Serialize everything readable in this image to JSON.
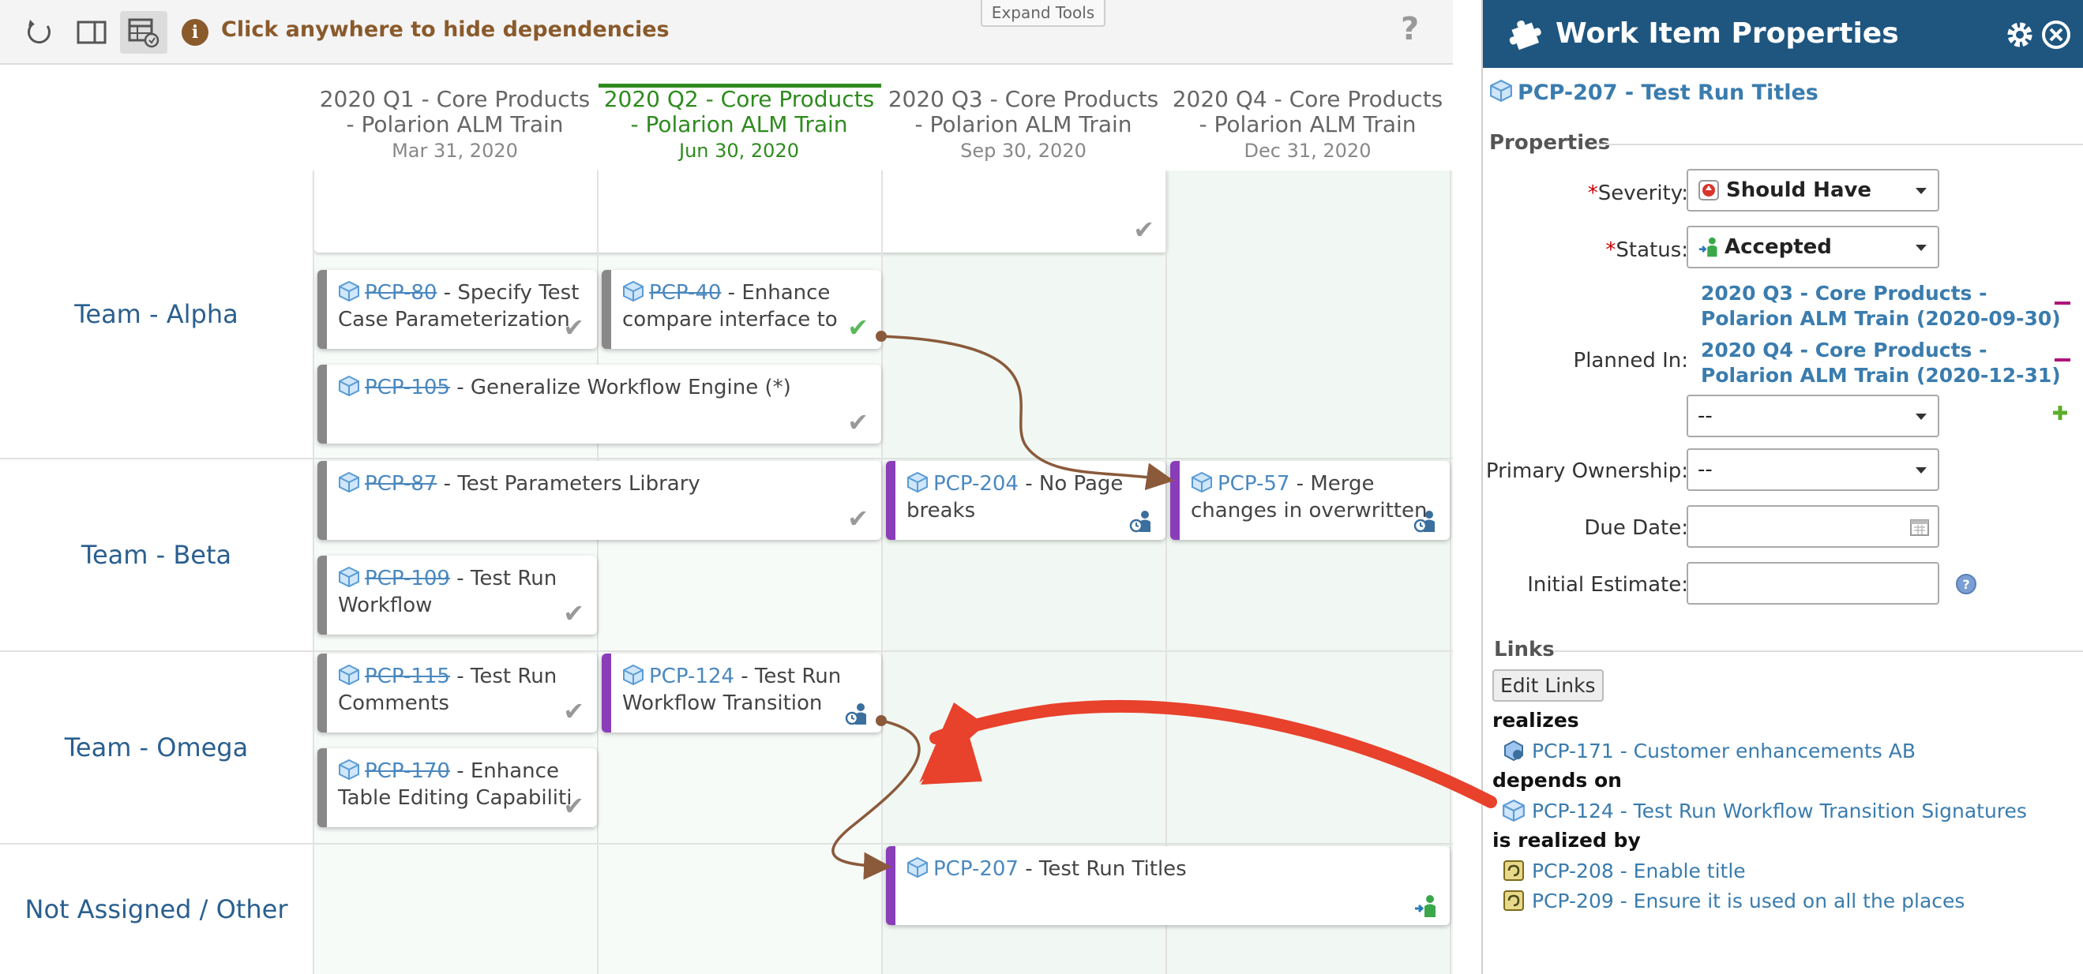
{
  "toolbar": {
    "hint": "Click anywhere to hide dependencies",
    "expand_tools": "Expand Tools",
    "help": "?"
  },
  "columns": [
    {
      "title": "2020 Q1 - Core Products - Polarion ALM Train",
      "date": "Mar 31, 2020",
      "current": false
    },
    {
      "title": "2020 Q2 - Core Products - Polarion ALM Train",
      "date": "Jun 30, 2020",
      "current": true
    },
    {
      "title": "2020 Q3 - Core Products - Polarion ALM Train",
      "date": "Sep 30, 2020",
      "current": false
    },
    {
      "title": "2020 Q4 - Core Products - Polarion ALM Train",
      "date": "Dec 31, 2020",
      "current": false
    }
  ],
  "rows": [
    "Team - Alpha",
    "Team - Beta",
    "Team - Omega",
    "Not Assigned / Other"
  ],
  "cards": [
    {
      "id": "PCP-80",
      "title": " - Specify Test Case Parameterization",
      "done": true
    },
    {
      "id": "PCP-40",
      "title": " - Enhance compare interface to",
      "done": true
    },
    {
      "id": "PCP-105",
      "title": " - Generalize Workflow Engine (*)",
      "done": true
    },
    {
      "id": "PCP-87",
      "title": " - Test Parameters Library",
      "done": true
    },
    {
      "id": "PCP-204",
      "title": " - No Page breaks",
      "done": false
    },
    {
      "id": "PCP-57",
      "title": " - Merge changes in overwritten",
      "done": false
    },
    {
      "id": "PCP-109",
      "title": " - Test Run Workflow",
      "done": true
    },
    {
      "id": "PCP-115",
      "title": " - Test Run Comments",
      "done": true
    },
    {
      "id": "PCP-124",
      "title": " - Test Run Workflow Transition",
      "done": false
    },
    {
      "id": "PCP-170",
      "title": " - Enhance Table Editing Capabiliti",
      "done": true
    },
    {
      "id": "PCP-207",
      "title": " - Test Run Titles",
      "done": false
    }
  ],
  "panel": {
    "title": "Work Item Properties",
    "item": "PCP-207 - Test Run Titles",
    "properties_header": "Properties",
    "severity_label": "Severity:",
    "severity_value": "Should Have",
    "status_label": "Status:",
    "status_value": "Accepted",
    "planned_label": "Planned In:",
    "planned": [
      "2020 Q3 - Core Products - Polarion ALM Train (2020-09-30)",
      "2020 Q4 - Core Products - Polarion ALM Train (2020-12-31)"
    ],
    "planned_select": "--",
    "ownership_label": "Primary Ownership:",
    "ownership_value": "--",
    "due_label": "Due Date:",
    "estimate_label": "Initial Estimate:",
    "links_header": "Links",
    "edit_links": "Edit Links",
    "realizes": "realizes",
    "realizes_item": "PCP-171 - Customer enhancements AB",
    "depends_on": "depends on",
    "depends_item": "PCP-124 - Test Run Workflow Transition Signatures",
    "realized_by": "is realized by",
    "realized_items": [
      "PCP-208 - Enable title",
      "PCP-209 - Ensure it is used on all the places"
    ]
  },
  "colors": {
    "panel_header": "#1f5680",
    "current_column": "#2e8b1e",
    "row_label": "#2a5f8f",
    "card_in_progress": "#8a3db8",
    "callout_arrow": "#e8412c",
    "dependency_arrow": "#8a5a3b"
  }
}
